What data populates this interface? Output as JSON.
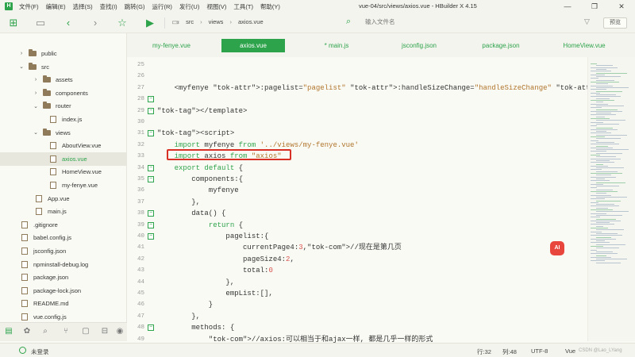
{
  "window": {
    "title": "vue-04/src/views/axios.vue - HBuilder X 4.15",
    "controls": [
      "—",
      "❐",
      "✕"
    ]
  },
  "menu": [
    "文件(F)",
    "编辑(E)",
    "选择(S)",
    "查找(I)",
    "跳转(G)",
    "运行(R)",
    "发行(U)",
    "视图(V)",
    "工具(T)",
    "帮助(Y)"
  ],
  "toolbar": {
    "breadcrumb": [
      "src",
      "views",
      "axios.vue"
    ],
    "file_search_placeholder": "输入文件名",
    "preview_label": "预览"
  },
  "sidebar": {
    "tree": [
      {
        "label": "public",
        "type": "folder",
        "expanded": false,
        "level": 1
      },
      {
        "label": "src",
        "type": "folder",
        "expanded": true,
        "level": 1
      },
      {
        "label": "assets",
        "type": "folder",
        "expanded": false,
        "level": 2
      },
      {
        "label": "components",
        "type": "folder",
        "expanded": false,
        "level": 2
      },
      {
        "label": "router",
        "type": "folder",
        "expanded": true,
        "level": 2
      },
      {
        "label": "index.js",
        "type": "file",
        "level": 3
      },
      {
        "label": "views",
        "type": "folder",
        "expanded": true,
        "level": 2
      },
      {
        "label": "AboutView.vue",
        "type": "file",
        "level": 3
      },
      {
        "label": "axios.vue",
        "type": "file",
        "level": 3,
        "selected": true
      },
      {
        "label": "HomeView.vue",
        "type": "file",
        "level": 3
      },
      {
        "label": "my-fenye.vue",
        "type": "file",
        "level": 3
      },
      {
        "label": "App.vue",
        "type": "file",
        "level": 2
      },
      {
        "label": "main.js",
        "type": "file",
        "level": 2
      },
      {
        "label": ".gitignore",
        "type": "file",
        "level": 1
      },
      {
        "label": "babel.config.js",
        "type": "file",
        "level": 1
      },
      {
        "label": "jsconfig.json",
        "type": "file",
        "level": 1
      },
      {
        "label": "npminstall-debug.log",
        "type": "file",
        "level": 1
      },
      {
        "label": "package.json",
        "type": "file",
        "level": 1
      },
      {
        "label": "package-lock.json",
        "type": "file",
        "level": 1
      },
      {
        "label": "README.md",
        "type": "file",
        "level": 1
      },
      {
        "label": "vue.config.js",
        "type": "file",
        "level": 1
      }
    ]
  },
  "tabs": [
    {
      "label": "my-fenye.vue",
      "active": false
    },
    {
      "label": "axios.vue",
      "active": true
    },
    {
      "label": "* main.js",
      "active": false
    },
    {
      "label": "jsconfig.json",
      "active": false
    },
    {
      "label": "package.json",
      "active": false
    },
    {
      "label": "HomeView.vue",
      "active": false
    }
  ],
  "editor": {
    "lines": [
      {
        "num": "25",
        "text": ""
      },
      {
        "num": "26",
        "text": ""
      },
      {
        "num": "27",
        "text": "    <myfenye :pagelist=\"pagelist\" :handleSizeChange=\"handleSizeChange\" :handleCurrentChange=\"handle"
      },
      {
        "num": "28",
        "text": ""
      },
      {
        "num": "29",
        "text": "</template>"
      },
      {
        "num": "30",
        "text": ""
      },
      {
        "num": "31",
        "text": "<script>"
      },
      {
        "num": "32",
        "text": "    import myfenye from '../views/my-fenye.vue'"
      },
      {
        "num": "33",
        "text": "    import axios from \"axios\""
      },
      {
        "num": "34",
        "text": "    export default {"
      },
      {
        "num": "35",
        "text": "        components:{"
      },
      {
        "num": "36",
        "text": "            myfenye"
      },
      {
        "num": "37",
        "text": "        },"
      },
      {
        "num": "38",
        "text": "        data() {"
      },
      {
        "num": "39",
        "text": "            return {"
      },
      {
        "num": "40",
        "text": "                pagelist:{"
      },
      {
        "num": "41",
        "text": "                    currentPage4:3,//现在是第几页"
      },
      {
        "num": "42",
        "text": "                    pageSize4:2,"
      },
      {
        "num": "43",
        "text": "                    total:0"
      },
      {
        "num": "44",
        "text": "                },"
      },
      {
        "num": "45",
        "text": "                empList:[],"
      },
      {
        "num": "46",
        "text": "            }"
      },
      {
        "num": "47",
        "text": "        },"
      },
      {
        "num": "48",
        "text": "        methods: {"
      },
      {
        "num": "49",
        "text": "            //axios:可以相当于和ajax一样, 都是几乎一样的形式"
      }
    ]
  },
  "ai_badge": "AI",
  "status": {
    "login": "未登录",
    "position": "行:32",
    "column": "列:48",
    "encoding": "UTF-8",
    "language": "Vue",
    "watermark": "CSDN @Lao_LYang"
  },
  "colors": {
    "accent": "#2da34b",
    "highlight_box": "#d93025",
    "ai_badge": "#e8453c"
  }
}
